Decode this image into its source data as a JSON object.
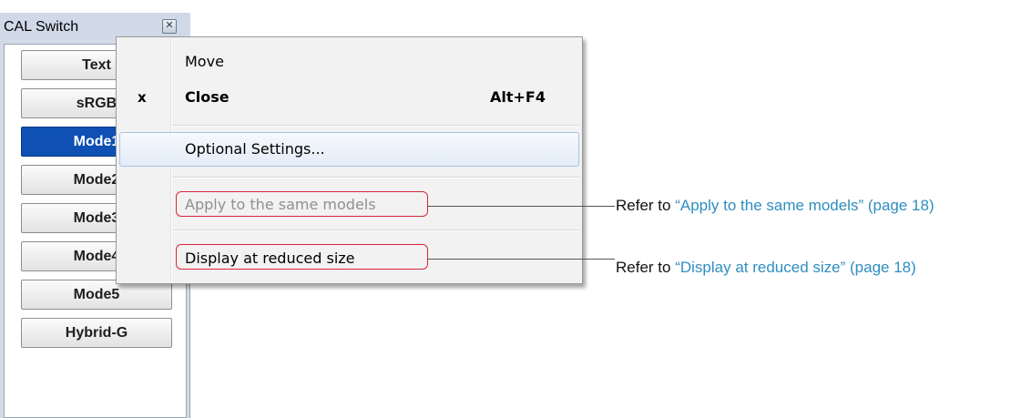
{
  "window": {
    "title": "CAL Switch",
    "close_glyph": "✕",
    "buttons": [
      {
        "label": "Text",
        "active": false
      },
      {
        "label": "sRGB",
        "active": false
      },
      {
        "label": "Mode1",
        "active": true
      },
      {
        "label": "Mode2",
        "active": false
      },
      {
        "label": "Mode3",
        "active": false
      },
      {
        "label": "Mode4",
        "active": false
      },
      {
        "label": "Mode5",
        "active": false
      },
      {
        "label": "Hybrid-G",
        "active": false
      }
    ]
  },
  "context_menu": {
    "items": {
      "move": {
        "label": "Move"
      },
      "close": {
        "label": "Close",
        "glyph": "x",
        "shortcut": "Alt+F4"
      },
      "optional_settings": {
        "label": "Optional Settings..."
      },
      "apply_same_models": {
        "label": "Apply to the same models",
        "disabled": true
      },
      "display_reduced": {
        "label": "Display at reduced size"
      }
    }
  },
  "annotations": [
    {
      "prefix": "Refer to ",
      "reference": "“Apply to the same models” (page 18)"
    },
    {
      "prefix": "Refer to ",
      "reference": "“Display at reduced size” (page 18)"
    }
  ],
  "colors": {
    "active_button": "#0e50b4",
    "callout_border": "#d9263a",
    "reference_link": "#2f8ec1",
    "disabled_text": "#8f8f8f"
  }
}
